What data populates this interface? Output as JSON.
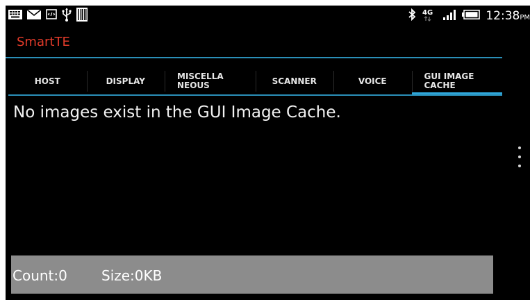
{
  "status_bar": {
    "left_icons": [
      "keyboard-icon",
      "mail-icon",
      "screenshot-icon",
      "usb-icon",
      "barcode-icon"
    ],
    "right_icons": [
      "bluetooth-icon",
      "network-4g-icon",
      "signal-icon",
      "battery-icon"
    ],
    "network_label": "4G",
    "time": "12:38",
    "ampm": "PM"
  },
  "action_bar": {
    "title": "SmartTE",
    "title_color": "#e23b2a",
    "accent_color": "#2a8fb8"
  },
  "tabs": [
    {
      "label": "HOST",
      "active": false
    },
    {
      "label": "DISPLAY",
      "active": false
    },
    {
      "label": "MISCELLA\nNEOUS",
      "active": false
    },
    {
      "label": "SCANNER",
      "active": false
    },
    {
      "label": "VOICE",
      "active": false
    },
    {
      "label": "GUI IMAGE\nCACHE",
      "active": true
    }
  ],
  "main": {
    "message": "No images exist in the GUI Image Cache."
  },
  "overflow_menu": {
    "icon": "overflow-menu-icon"
  },
  "bottom_bar": {
    "count": "Count:0",
    "size": "Size:0KB",
    "background": "#8c8c8c"
  }
}
